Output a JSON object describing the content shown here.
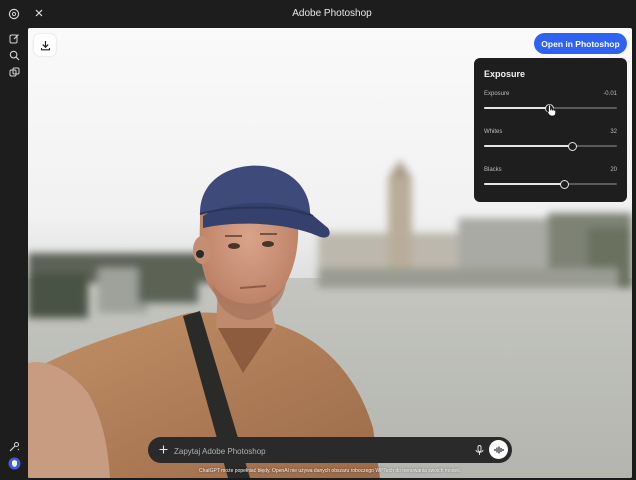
{
  "window": {
    "title": "Adobe Photoshop"
  },
  "rail": {
    "icons": [
      "openai-logo-icon",
      "edit-icon",
      "search-icon",
      "library-icon",
      "tools-icon",
      "shield-icon"
    ]
  },
  "toolbar": {
    "open_label": "Open in Photoshop"
  },
  "exposure_panel": {
    "title": "Exposure",
    "sliders": [
      {
        "label": "Exposure",
        "value": "-0.01",
        "level": 0.49
      },
      {
        "label": "Whites",
        "value": "32",
        "level": 0.66
      },
      {
        "label": "Blacks",
        "value": "20",
        "level": 0.6
      }
    ]
  },
  "composer": {
    "placeholder": "Zapytaj Adobe Photoshop"
  },
  "disclaimer": "ChatGPT może popełniać błędy. OpenAI nie używa danych obszaru roboczego WPTech do trenowania swoich modeli.",
  "colors": {
    "accent": "#2f62f1",
    "panel": "#1e1e1e",
    "frame": "#1d1d1d"
  }
}
